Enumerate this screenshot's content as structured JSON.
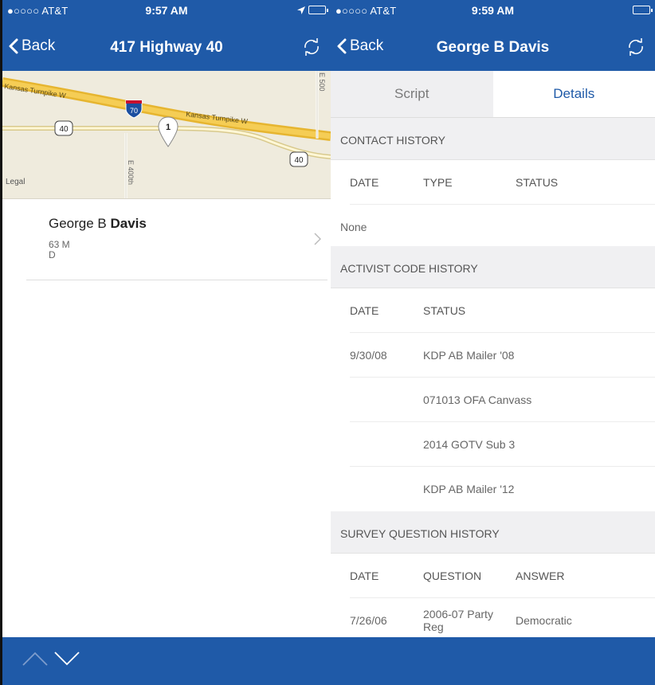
{
  "left": {
    "status": {
      "carrier": "●○○○○ AT&T",
      "time": "9:57 AM"
    },
    "nav": {
      "back": "Back",
      "title": "417 Highway 40"
    },
    "map": {
      "labels": [
        "Kansas Turnpike W",
        "Kansas Turnpike W",
        "70",
        "40",
        "40",
        "E 400th",
        "E 500",
        "1"
      ],
      "legal": "Legal"
    },
    "contact": {
      "first": "George B",
      "last": "Davis",
      "age_sex": "63 M",
      "party": "D"
    }
  },
  "right": {
    "status": {
      "carrier": "●○○○○ AT&T",
      "time": "9:59 AM"
    },
    "nav": {
      "back": "Back",
      "title": "George B Davis"
    },
    "tabs": {
      "script": "Script",
      "details": "Details"
    },
    "contact_history": {
      "title": "CONTACT HISTORY",
      "headers": [
        "DATE",
        "TYPE",
        "STATUS"
      ],
      "empty": "None"
    },
    "activist_history": {
      "title": "ACTIVIST CODE HISTORY",
      "headers": [
        "DATE",
        "STATUS"
      ],
      "rows": [
        [
          "9/30/08",
          "KDP AB Mailer '08"
        ],
        [
          "",
          "071013 OFA Canvass"
        ],
        [
          "",
          "2014 GOTV Sub 3"
        ],
        [
          "",
          "KDP AB Mailer '12"
        ]
      ]
    },
    "survey_history": {
      "title": "SURVEY QUESTION HISTORY",
      "headers": [
        "DATE",
        "QUESTION",
        "ANSWER"
      ],
      "rows": [
        [
          "7/26/06",
          "2006-07 Party Reg",
          "Democratic"
        ]
      ]
    }
  },
  "colors": {
    "bar": "#1f5aa8",
    "accent": "#1f5aa8",
    "section": "#f0f0f2"
  }
}
